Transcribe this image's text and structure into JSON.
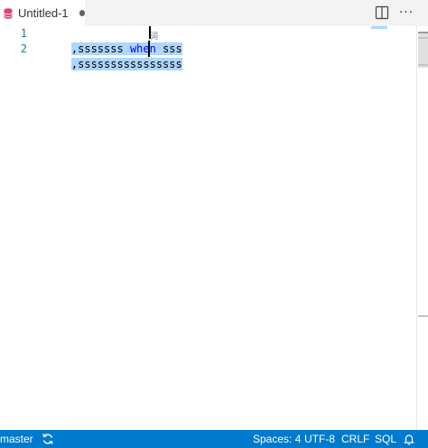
{
  "tab": {
    "title": "Untitled-1",
    "icon": "database-icon",
    "dirty": true
  },
  "tab_actions": {
    "split_icon": "split-editor-icon",
    "more_label": "···"
  },
  "editor": {
    "lines": [
      {
        "number": "1",
        "parts": [
          ",sssssss ",
          "when",
          " sss"
        ]
      },
      {
        "number": "2",
        "text": ",ssssssssssssssss"
      }
    ],
    "ime_hint": "词",
    "selection_color": "#add6ff",
    "keyword_color": "#0000ff"
  },
  "status": {
    "branch": "master",
    "sync_icon": "sync-icon",
    "spaces": "Spaces: 4",
    "encoding": "UTF-8",
    "eol": "CRLF",
    "language": "SQL",
    "bell_icon": "bell-icon",
    "background": "#007acc"
  }
}
